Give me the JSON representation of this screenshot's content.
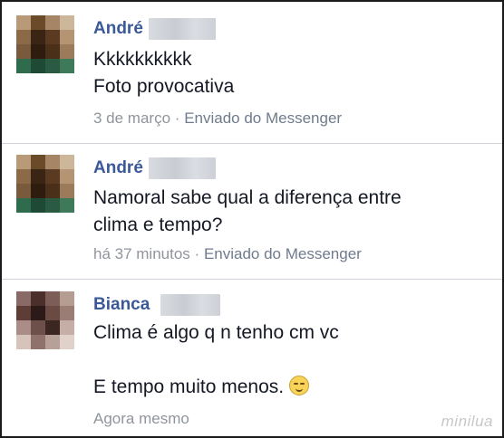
{
  "messages": [
    {
      "name": "André",
      "lines": [
        "Kkkkkkkkkk",
        "Foto provocativa"
      ],
      "time": "3 de março",
      "separator": "·",
      "via": "Enviado do Messenger"
    },
    {
      "name": "André",
      "lines": [
        "Namoral sabe qual a diferença entre",
        "clima e tempo?"
      ],
      "time": "há 37 minutos",
      "separator": "·",
      "via": "Enviado do Messenger"
    },
    {
      "name": "Bianca",
      "lines": [
        "Clima é algo q n tenho cm vc",
        "E tempo muito menos."
      ],
      "time": "Agora mesmo",
      "emoji": "relieved-face-emoji"
    }
  ],
  "watermark": "minilua",
  "colors": {
    "name": "#3b5998",
    "text": "#141823",
    "meta": "#90949c",
    "divider": "#cfd3da"
  }
}
